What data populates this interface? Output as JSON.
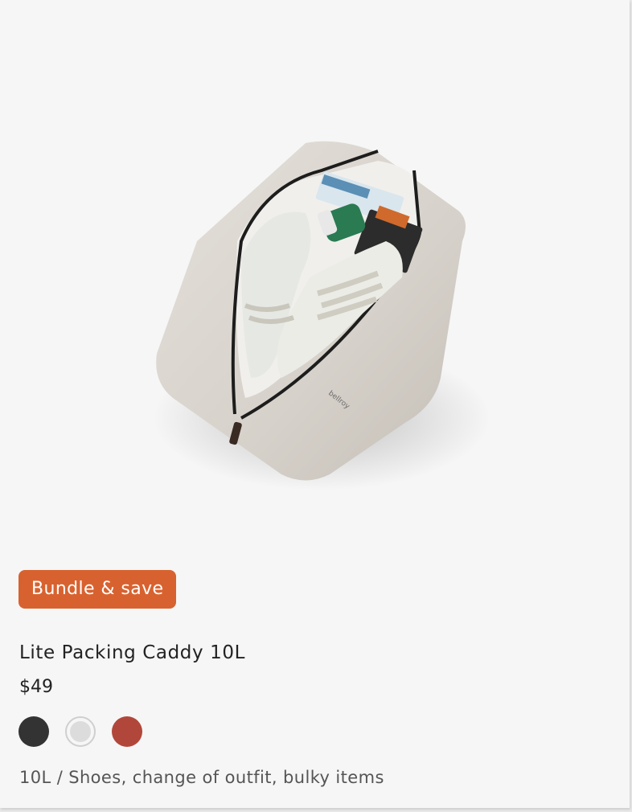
{
  "product": {
    "badge": "Bundle & save",
    "title": "Lite Packing Caddy 10L",
    "price": "$49",
    "description": "10L / Shoes, change of outfit, bulky items",
    "image_alt": "Lite Packing Caddy 10L open with shoes, bottle and packed items inside",
    "swatches": [
      {
        "name": "charcoal",
        "color": "#333333",
        "selected": false
      },
      {
        "name": "chalk",
        "color": "#dcdcdc",
        "selected": true
      },
      {
        "name": "rust",
        "color": "#b1473a",
        "selected": false
      }
    ]
  },
  "colors": {
    "badge_bg": "#d8622f",
    "card_bg": "#f6f6f6"
  }
}
